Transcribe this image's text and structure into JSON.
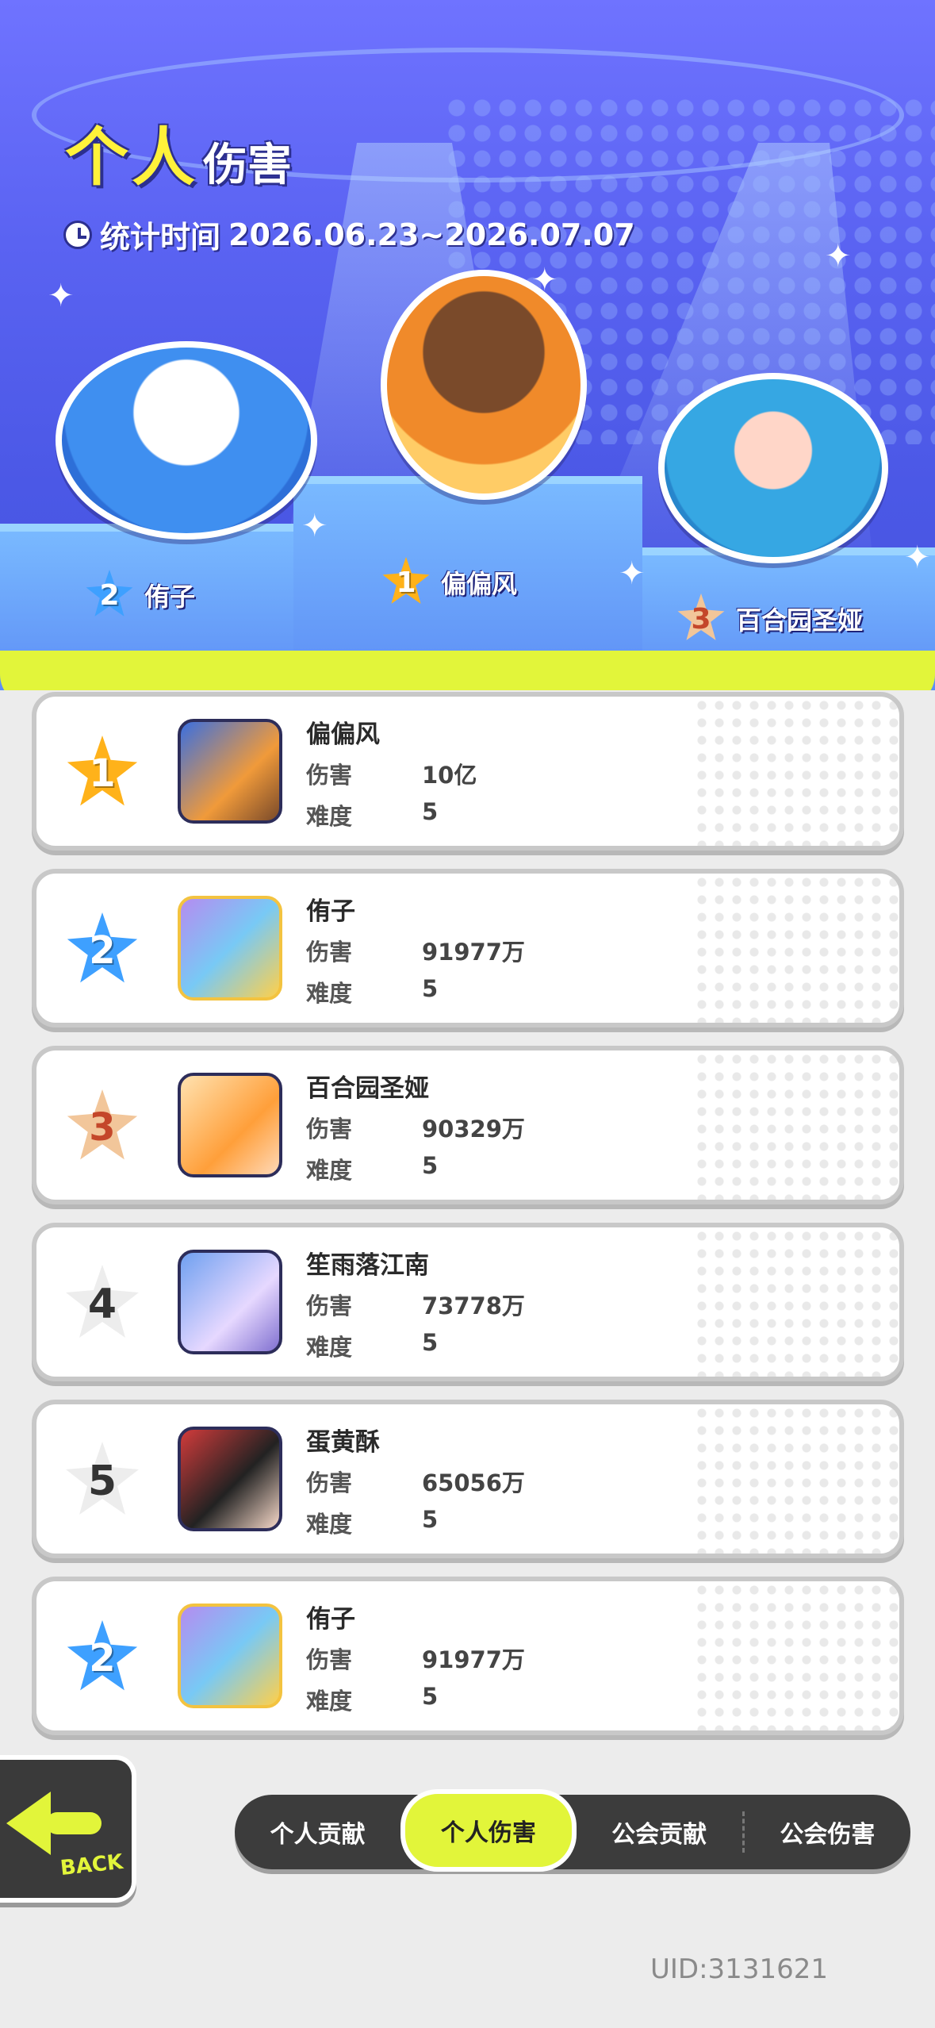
{
  "header": {
    "title_big": "个人",
    "title_small": "伤害",
    "stat_time_label": "统计时间",
    "stat_time_range": "2026.06.23~2026.07.07"
  },
  "podium": [
    {
      "rank": "2",
      "name": "侑子"
    },
    {
      "rank": "1",
      "name": "偏偏风"
    },
    {
      "rank": "3",
      "name": "百合园圣娅"
    }
  ],
  "labels": {
    "damage": "伤害",
    "difficulty": "难度"
  },
  "ranking": [
    {
      "rank": "1",
      "name": "偏偏风",
      "damage": "10亿",
      "difficulty": "5"
    },
    {
      "rank": "2",
      "name": "侑子",
      "damage": "91977万",
      "difficulty": "5"
    },
    {
      "rank": "3",
      "name": "百合园圣娅",
      "damage": "90329万",
      "difficulty": "5"
    },
    {
      "rank": "4",
      "name": "笙雨落江南",
      "damage": "73778万",
      "difficulty": "5"
    },
    {
      "rank": "5",
      "name": "蛋黄酥",
      "damage": "65056万",
      "difficulty": "5"
    },
    {
      "rank": "2",
      "name": "侑子",
      "damage": "91977万",
      "difficulty": "5"
    }
  ],
  "back_button": {
    "label": "BACK"
  },
  "tabs": [
    {
      "label": "个人贡献",
      "active": false
    },
    {
      "label": "个人伤害",
      "active": true
    },
    {
      "label": "公会贡献",
      "active": false
    },
    {
      "label": "公会伤害",
      "active": false
    }
  ],
  "uid": "UID:3131621",
  "colors": {
    "accent": "#e2f53a",
    "hero_bg": "#5a63f2",
    "gold": "#ffb21a",
    "silver_blue": "#3ea0ff",
    "bronze": "#f2c69a"
  }
}
